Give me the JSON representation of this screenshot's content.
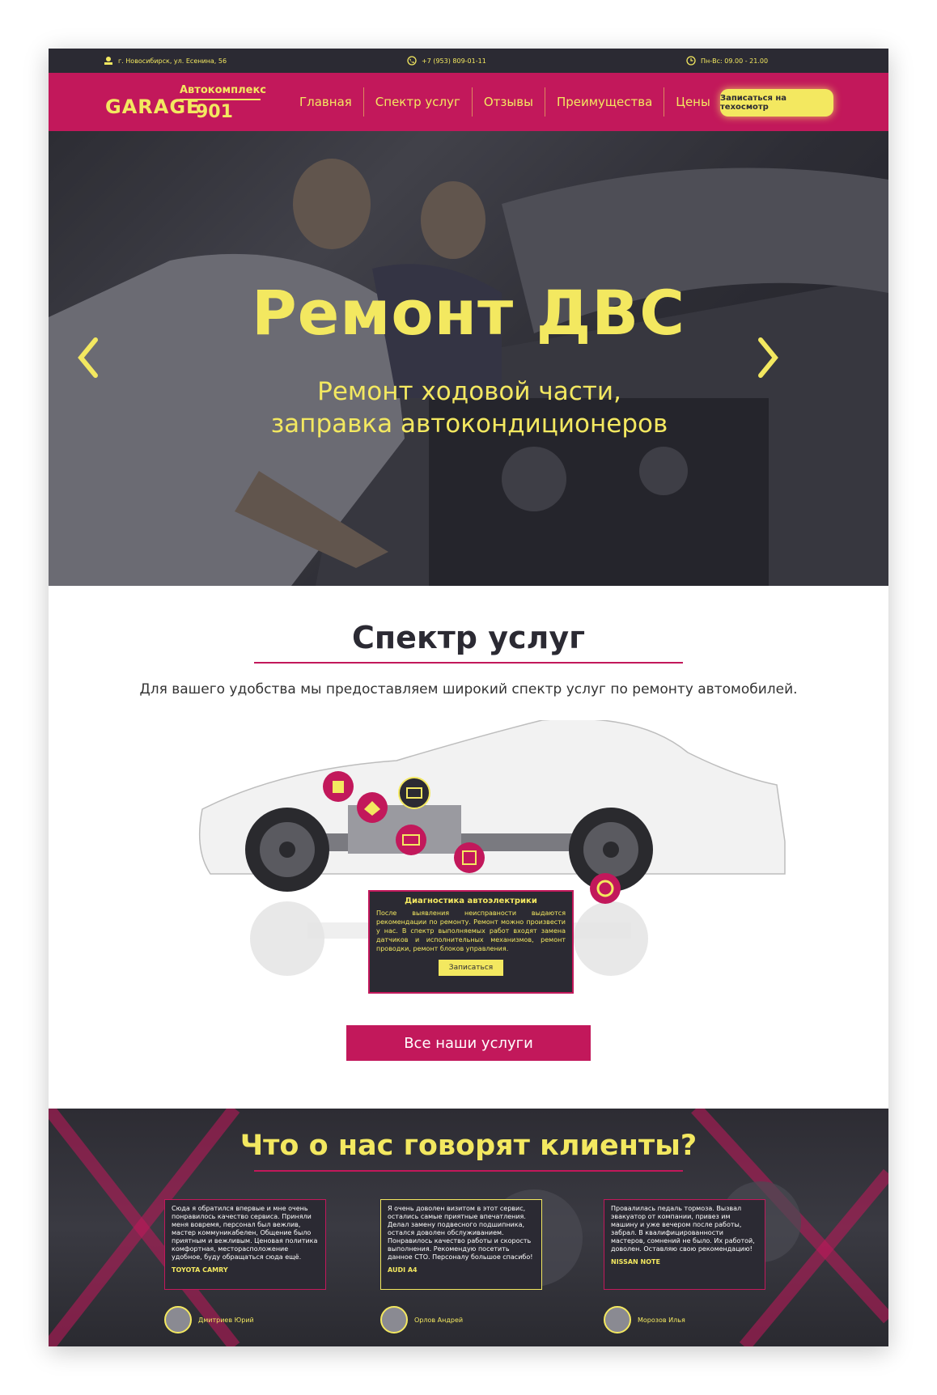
{
  "topbar": {
    "address": "г. Новосибирск, ул. Есенина, 56",
    "phone": "+7 (953) 809-01-11",
    "hours": "Пн-Вс: 09.00 - 21.00"
  },
  "nav": {
    "logo": {
      "brand": "GARAGE",
      "subtitle": "Автокомплекс",
      "number": "901"
    },
    "items": [
      "Главная",
      "Спектр услуг",
      "Отзывы",
      "Преимущества",
      "Цены"
    ],
    "cta": "Записаться на техосмотр"
  },
  "hero": {
    "title": "Ремонт ДВС",
    "subtitle": "Ремонт ходовой части, заправка автокондиционеров"
  },
  "services": {
    "title": "Спектр услуг",
    "description": "Для вашего удобства мы предоставляем широкий спектр услуг по ремонту автомобилей.",
    "tooltip": {
      "title": "Диагностика автоэлектрики",
      "text": "После выявления неисправности выдаются рекомендации по ремонту. Ремонт можно произвести у нас. В спектр выполняемых работ входят замена датчиков и исполнительных механизмов, ремонт проводки, ремонт блоков управления.",
      "button": "Записаться"
    },
    "all_button": "Все наши услуги"
  },
  "reviews": {
    "title": "Что о нас говорят клиенты?",
    "items": [
      {
        "text": "Сюда я обратился впервые и мне очень понравилось качество сервиса. Приняли меня вовремя, персонал был вежлив, мастер коммуникабелен, Общение было приятным и вежливым. Ценовая политика комфортная, месторасположение удобное, буду обращаться сюда ещё.",
        "car": "TOYOTA CAMRY",
        "author": "Дмитриев Юрий"
      },
      {
        "text": "Я очень доволен визитом в этот сервис, остались самые приятные впечатления. Делал замену подвесного подшипника, остался доволен обслуживанием. Понравилось качество работы и скорость выполнения. Рекомендую посетить данное СТО. Персоналу большое спасибо!",
        "car": "AUDI A4",
        "author": "Орлов Андрей"
      },
      {
        "text": "Провалилась педаль тормоза. Вызвал эвакуатор от компании, привез им машину и уже вечером после работы, забрал. В квалифицированности мастеров, сомнений не было. Их работой, доволен. Оставляю свою рекомендацию!",
        "car": "NISSAN NOTE",
        "author": "Морозов Илья"
      }
    ]
  },
  "colors": {
    "accent": "#c2185b",
    "yellow": "#f3e860",
    "dark": "#2b2a33"
  }
}
